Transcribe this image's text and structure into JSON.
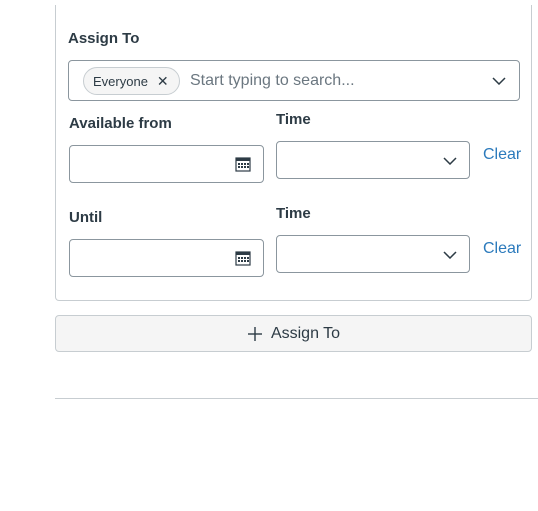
{
  "assign_section": {
    "assign_to_label": "Assign To",
    "selected_pill": "Everyone",
    "pill_remove_icon": "close-icon",
    "search_placeholder": "Start typing to search..."
  },
  "available_from": {
    "date_label": "Available from",
    "time_label": "Time",
    "clear_label": "Clear"
  },
  "until": {
    "date_label": "Until",
    "time_label": "Time",
    "clear_label": "Clear"
  },
  "add_button": {
    "label": "Assign To",
    "icon": "plus-icon"
  },
  "colors": {
    "link": "#2b7abc",
    "border": "#c7cdd1",
    "text": "#2d3b45",
    "button_bg": "#f5f5f5"
  }
}
